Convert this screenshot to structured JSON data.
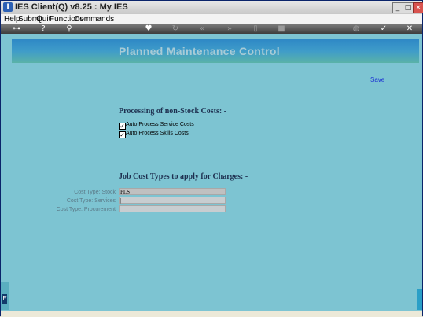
{
  "window": {
    "title": "IES Client(Q) v8.25 : My IES",
    "app_icon": "I",
    "controls": {
      "minimize": "_",
      "maximize": "□",
      "close": "×"
    }
  },
  "menu": {
    "items": [
      "Help",
      "Submit",
      "Quit",
      "Functions",
      "Commands"
    ]
  },
  "toolbar": {
    "icons": [
      "key-icon",
      "help-icon",
      "search-icon",
      "heart-icon",
      "refresh-icon",
      "rewind-icon",
      "fast-forward-icon",
      "document-icon",
      "stop-icon",
      "globe-icon",
      "check-icon",
      "close-icon"
    ]
  },
  "page": {
    "title": "Planned Maintenance Control",
    "save": "Save"
  },
  "processing": {
    "heading": "Processing of non-Stock Costs: -",
    "options": [
      {
        "label": "Auto Process Service Costs",
        "checked": true
      },
      {
        "label": "Auto Process Skills Costs",
        "checked": true
      }
    ]
  },
  "job_cost": {
    "heading": "Job Cost Types to apply for Charges: -",
    "fields": [
      {
        "label": "Cost Type: Stock",
        "value": "PLS"
      },
      {
        "label": "Cost Type: Services",
        "value": "|"
      },
      {
        "label": "Cost Type: Procurement",
        "value": ""
      }
    ]
  },
  "colors": {
    "content_bg": "#7dc4d2",
    "header_gradient_start": "#2e88c6",
    "header_title": "#a8cbd6",
    "link": "#1a2fd3"
  }
}
